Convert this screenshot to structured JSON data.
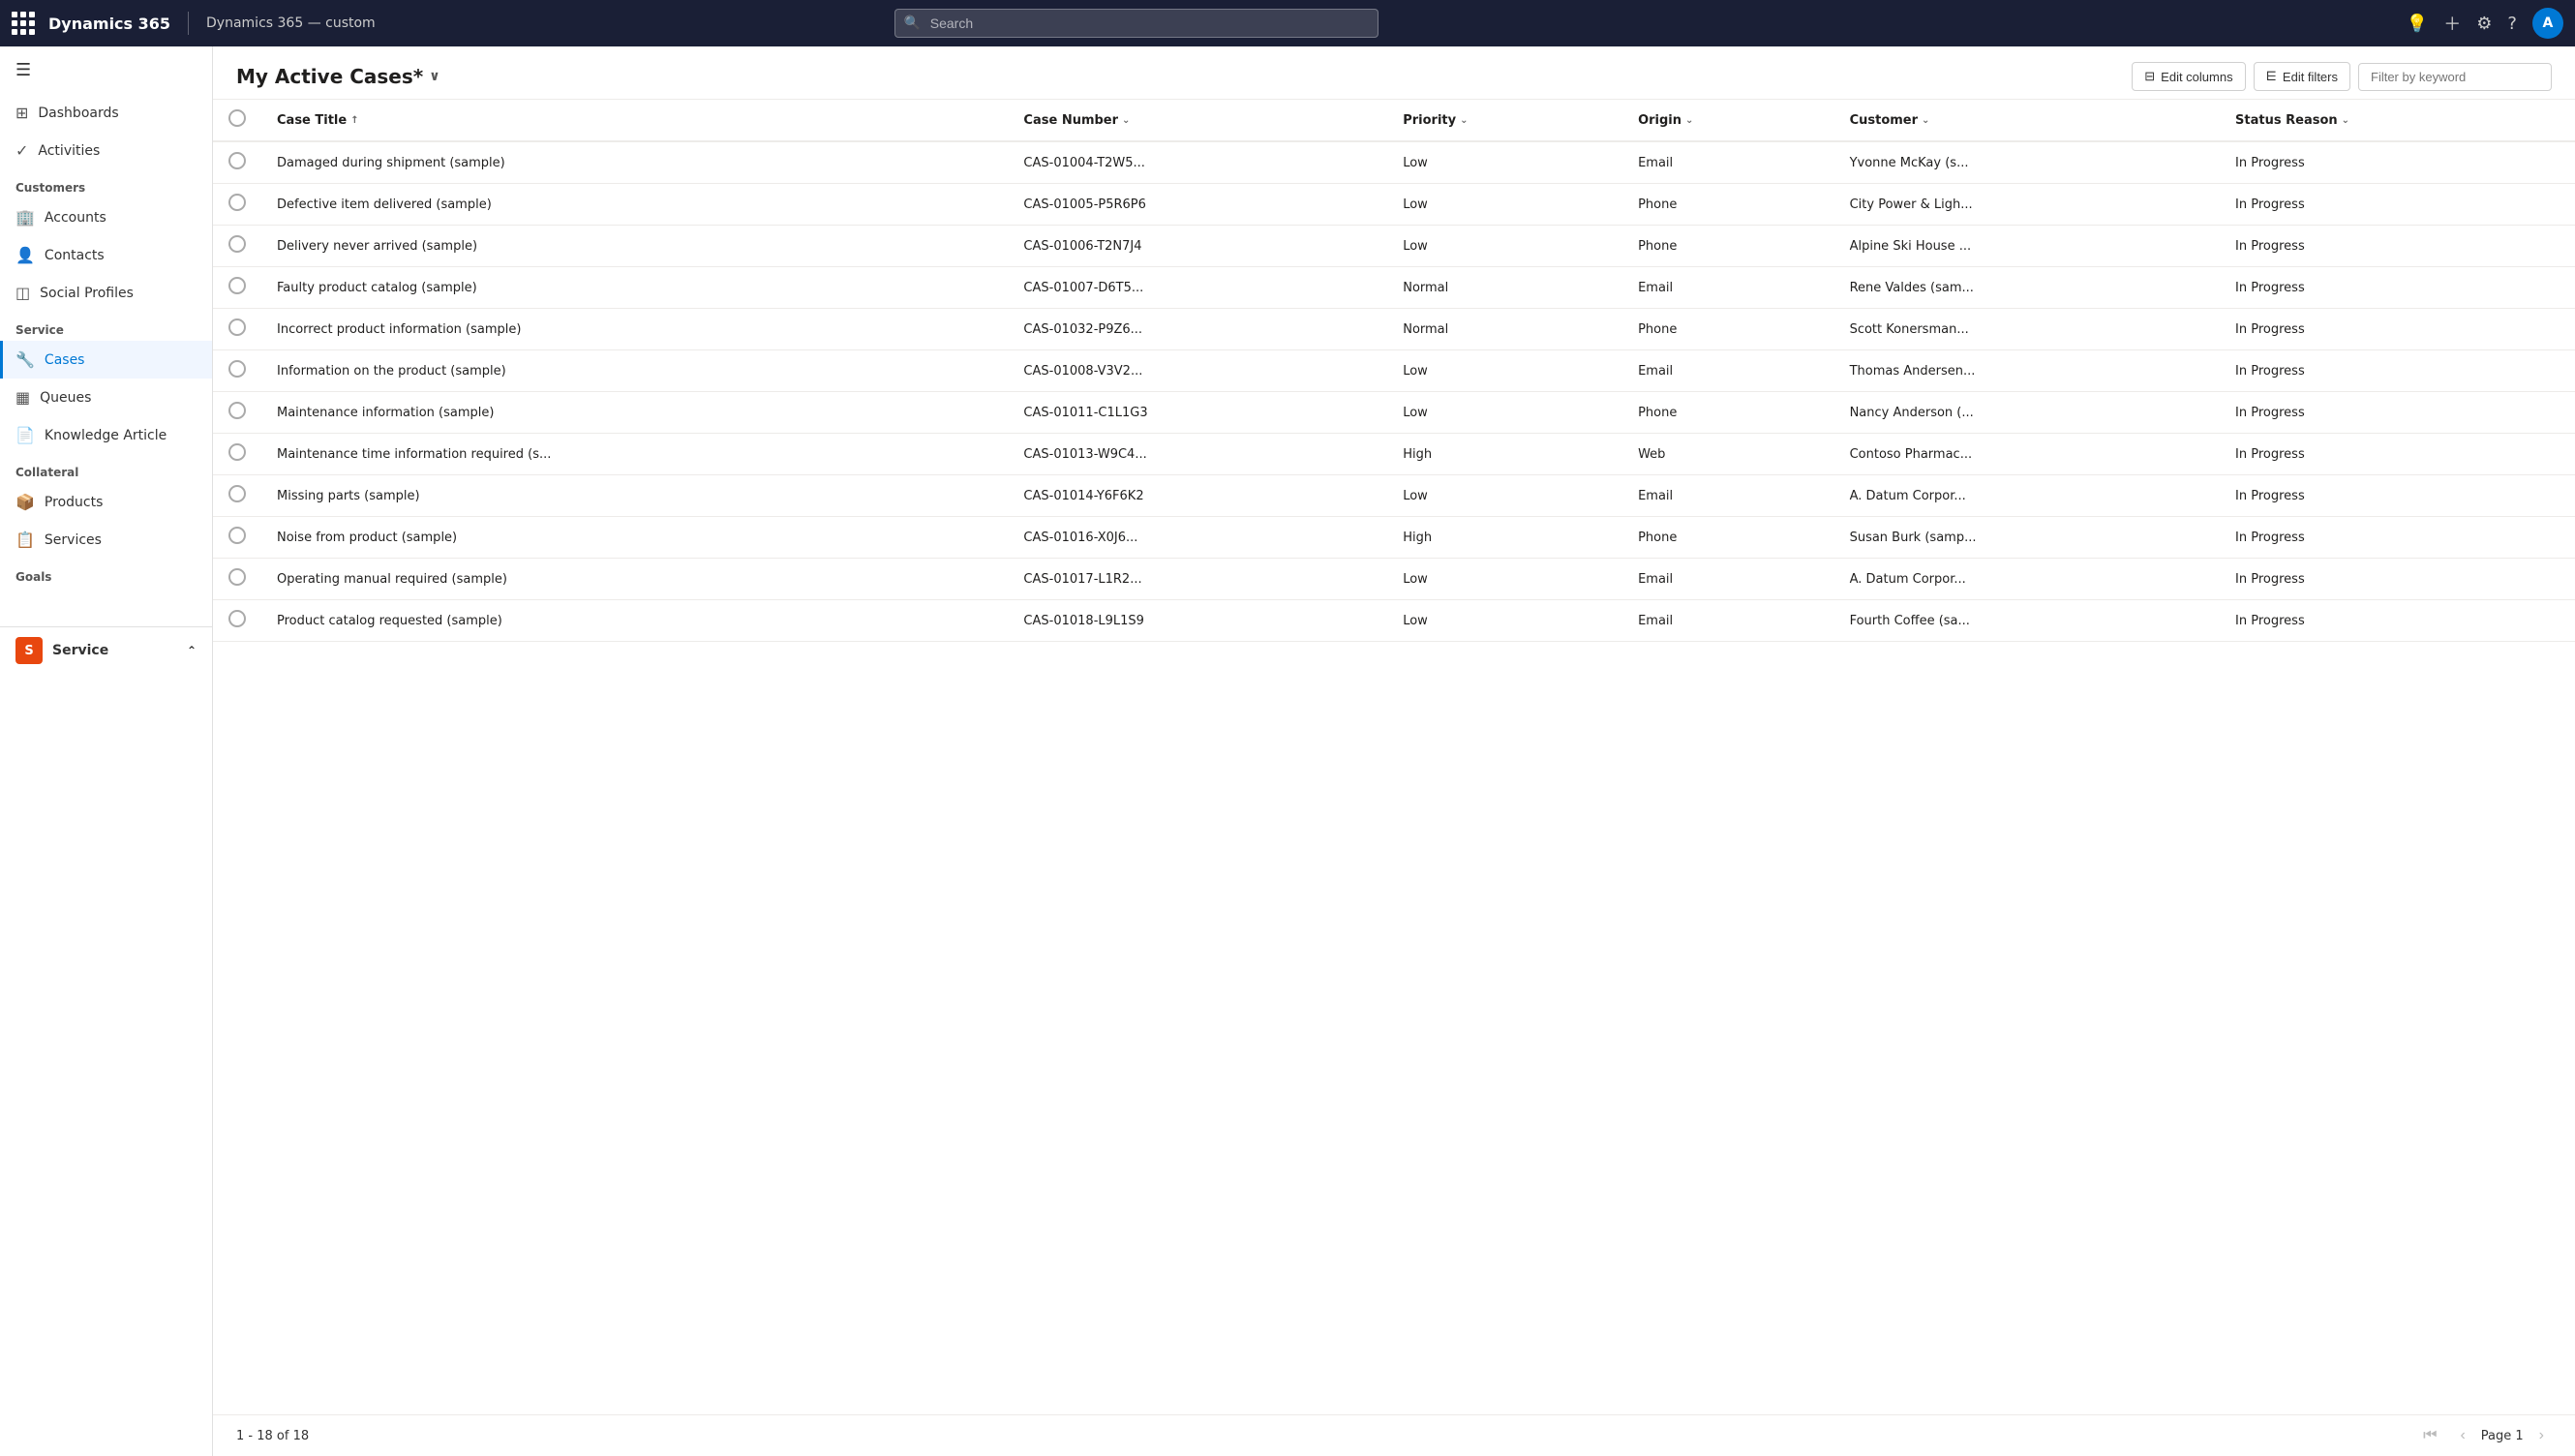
{
  "topNav": {
    "appName": "Dynamics 365",
    "envName": "Dynamics 365 — custom",
    "searchPlaceholder": "Search",
    "avatarInitial": "A",
    "icons": {
      "lightbulb": "💡",
      "plus": "+",
      "settings": "⚙",
      "help": "?"
    }
  },
  "sidebar": {
    "toggleIcon": "☰",
    "navItems": [
      {
        "id": "dashboards",
        "label": "Dashboards",
        "icon": "⊞"
      },
      {
        "id": "activities",
        "label": "Activities",
        "icon": "✓"
      }
    ],
    "sections": [
      {
        "label": "Customers",
        "items": [
          {
            "id": "accounts",
            "label": "Accounts",
            "icon": "🏢"
          },
          {
            "id": "contacts",
            "label": "Contacts",
            "icon": "👤"
          },
          {
            "id": "social-profiles",
            "label": "Social Profiles",
            "icon": "◫"
          }
        ]
      },
      {
        "label": "Service",
        "items": [
          {
            "id": "cases",
            "label": "Cases",
            "icon": "🔧",
            "active": true
          },
          {
            "id": "queues",
            "label": "Queues",
            "icon": "▦"
          },
          {
            "id": "knowledge-article",
            "label": "Knowledge Article",
            "icon": "📄"
          }
        ]
      },
      {
        "label": "Collateral",
        "items": [
          {
            "id": "products",
            "label": "Products",
            "icon": "📦"
          },
          {
            "id": "services",
            "label": "Services",
            "icon": "📋"
          }
        ]
      },
      {
        "label": "Goals",
        "items": []
      }
    ],
    "appSwitcher": {
      "badge": "S",
      "label": "Service",
      "chevron": "⌃"
    }
  },
  "view": {
    "title": "My Active Cases*",
    "chevronIcon": "∨",
    "editColumnsLabel": "Edit columns",
    "editFiltersLabel": "Edit filters",
    "filterPlaceholder": "Filter by keyword"
  },
  "table": {
    "columns": [
      {
        "id": "case-title",
        "label": "Case Title",
        "sortIcon": "↑",
        "sortable": true
      },
      {
        "id": "case-number",
        "label": "Case Number",
        "sortIcon": "⌄",
        "sortable": true
      },
      {
        "id": "priority",
        "label": "Priority",
        "sortIcon": "⌄",
        "sortable": true
      },
      {
        "id": "origin",
        "label": "Origin",
        "sortIcon": "⌄",
        "sortable": true
      },
      {
        "id": "customer",
        "label": "Customer",
        "sortIcon": "⌄",
        "sortable": true
      },
      {
        "id": "status-reason",
        "label": "Status Reason",
        "sortIcon": "⌄",
        "sortable": true
      }
    ],
    "rows": [
      {
        "title": "Damaged during shipment (sample)",
        "number": "CAS-01004-T2W5...",
        "priority": "Low",
        "origin": "Email",
        "customer": "Yvonne McKay (s...",
        "status": "In Progress"
      },
      {
        "title": "Defective item delivered (sample)",
        "number": "CAS-01005-P5R6P6",
        "priority": "Low",
        "origin": "Phone",
        "customer": "City Power & Ligh...",
        "status": "In Progress"
      },
      {
        "title": "Delivery never arrived (sample)",
        "number": "CAS-01006-T2N7J4",
        "priority": "Low",
        "origin": "Phone",
        "customer": "Alpine Ski House ...",
        "status": "In Progress"
      },
      {
        "title": "Faulty product catalog (sample)",
        "number": "CAS-01007-D6T5...",
        "priority": "Normal",
        "origin": "Email",
        "customer": "Rene Valdes (sam...",
        "status": "In Progress"
      },
      {
        "title": "Incorrect product information (sample)",
        "number": "CAS-01032-P9Z6...",
        "priority": "Normal",
        "origin": "Phone",
        "customer": "Scott Konersman...",
        "status": "In Progress"
      },
      {
        "title": "Information on the product (sample)",
        "number": "CAS-01008-V3V2...",
        "priority": "Low",
        "origin": "Email",
        "customer": "Thomas Andersen...",
        "status": "In Progress"
      },
      {
        "title": "Maintenance information (sample)",
        "number": "CAS-01011-C1L1G3",
        "priority": "Low",
        "origin": "Phone",
        "customer": "Nancy Anderson (...",
        "status": "In Progress"
      },
      {
        "title": "Maintenance time information required (s...",
        "number": "CAS-01013-W9C4...",
        "priority": "High",
        "origin": "Web",
        "customer": "Contoso Pharmac...",
        "status": "In Progress"
      },
      {
        "title": "Missing parts (sample)",
        "number": "CAS-01014-Y6F6K2",
        "priority": "Low",
        "origin": "Email",
        "customer": "A. Datum Corpor...",
        "status": "In Progress"
      },
      {
        "title": "Noise from product (sample)",
        "number": "CAS-01016-X0J6...",
        "priority": "High",
        "origin": "Phone",
        "customer": "Susan Burk (samp...",
        "status": "In Progress"
      },
      {
        "title": "Operating manual required (sample)",
        "number": "CAS-01017-L1R2...",
        "priority": "Low",
        "origin": "Email",
        "customer": "A. Datum Corpor...",
        "status": "In Progress"
      },
      {
        "title": "Product catalog requested (sample)",
        "number": "CAS-01018-L9L1S9",
        "priority": "Low",
        "origin": "Email",
        "customer": "Fourth Coffee (sa...",
        "status": "In Progress"
      }
    ]
  },
  "pagination": {
    "summary": "1 - 18 of 18",
    "pageLabel": "Page 1"
  }
}
